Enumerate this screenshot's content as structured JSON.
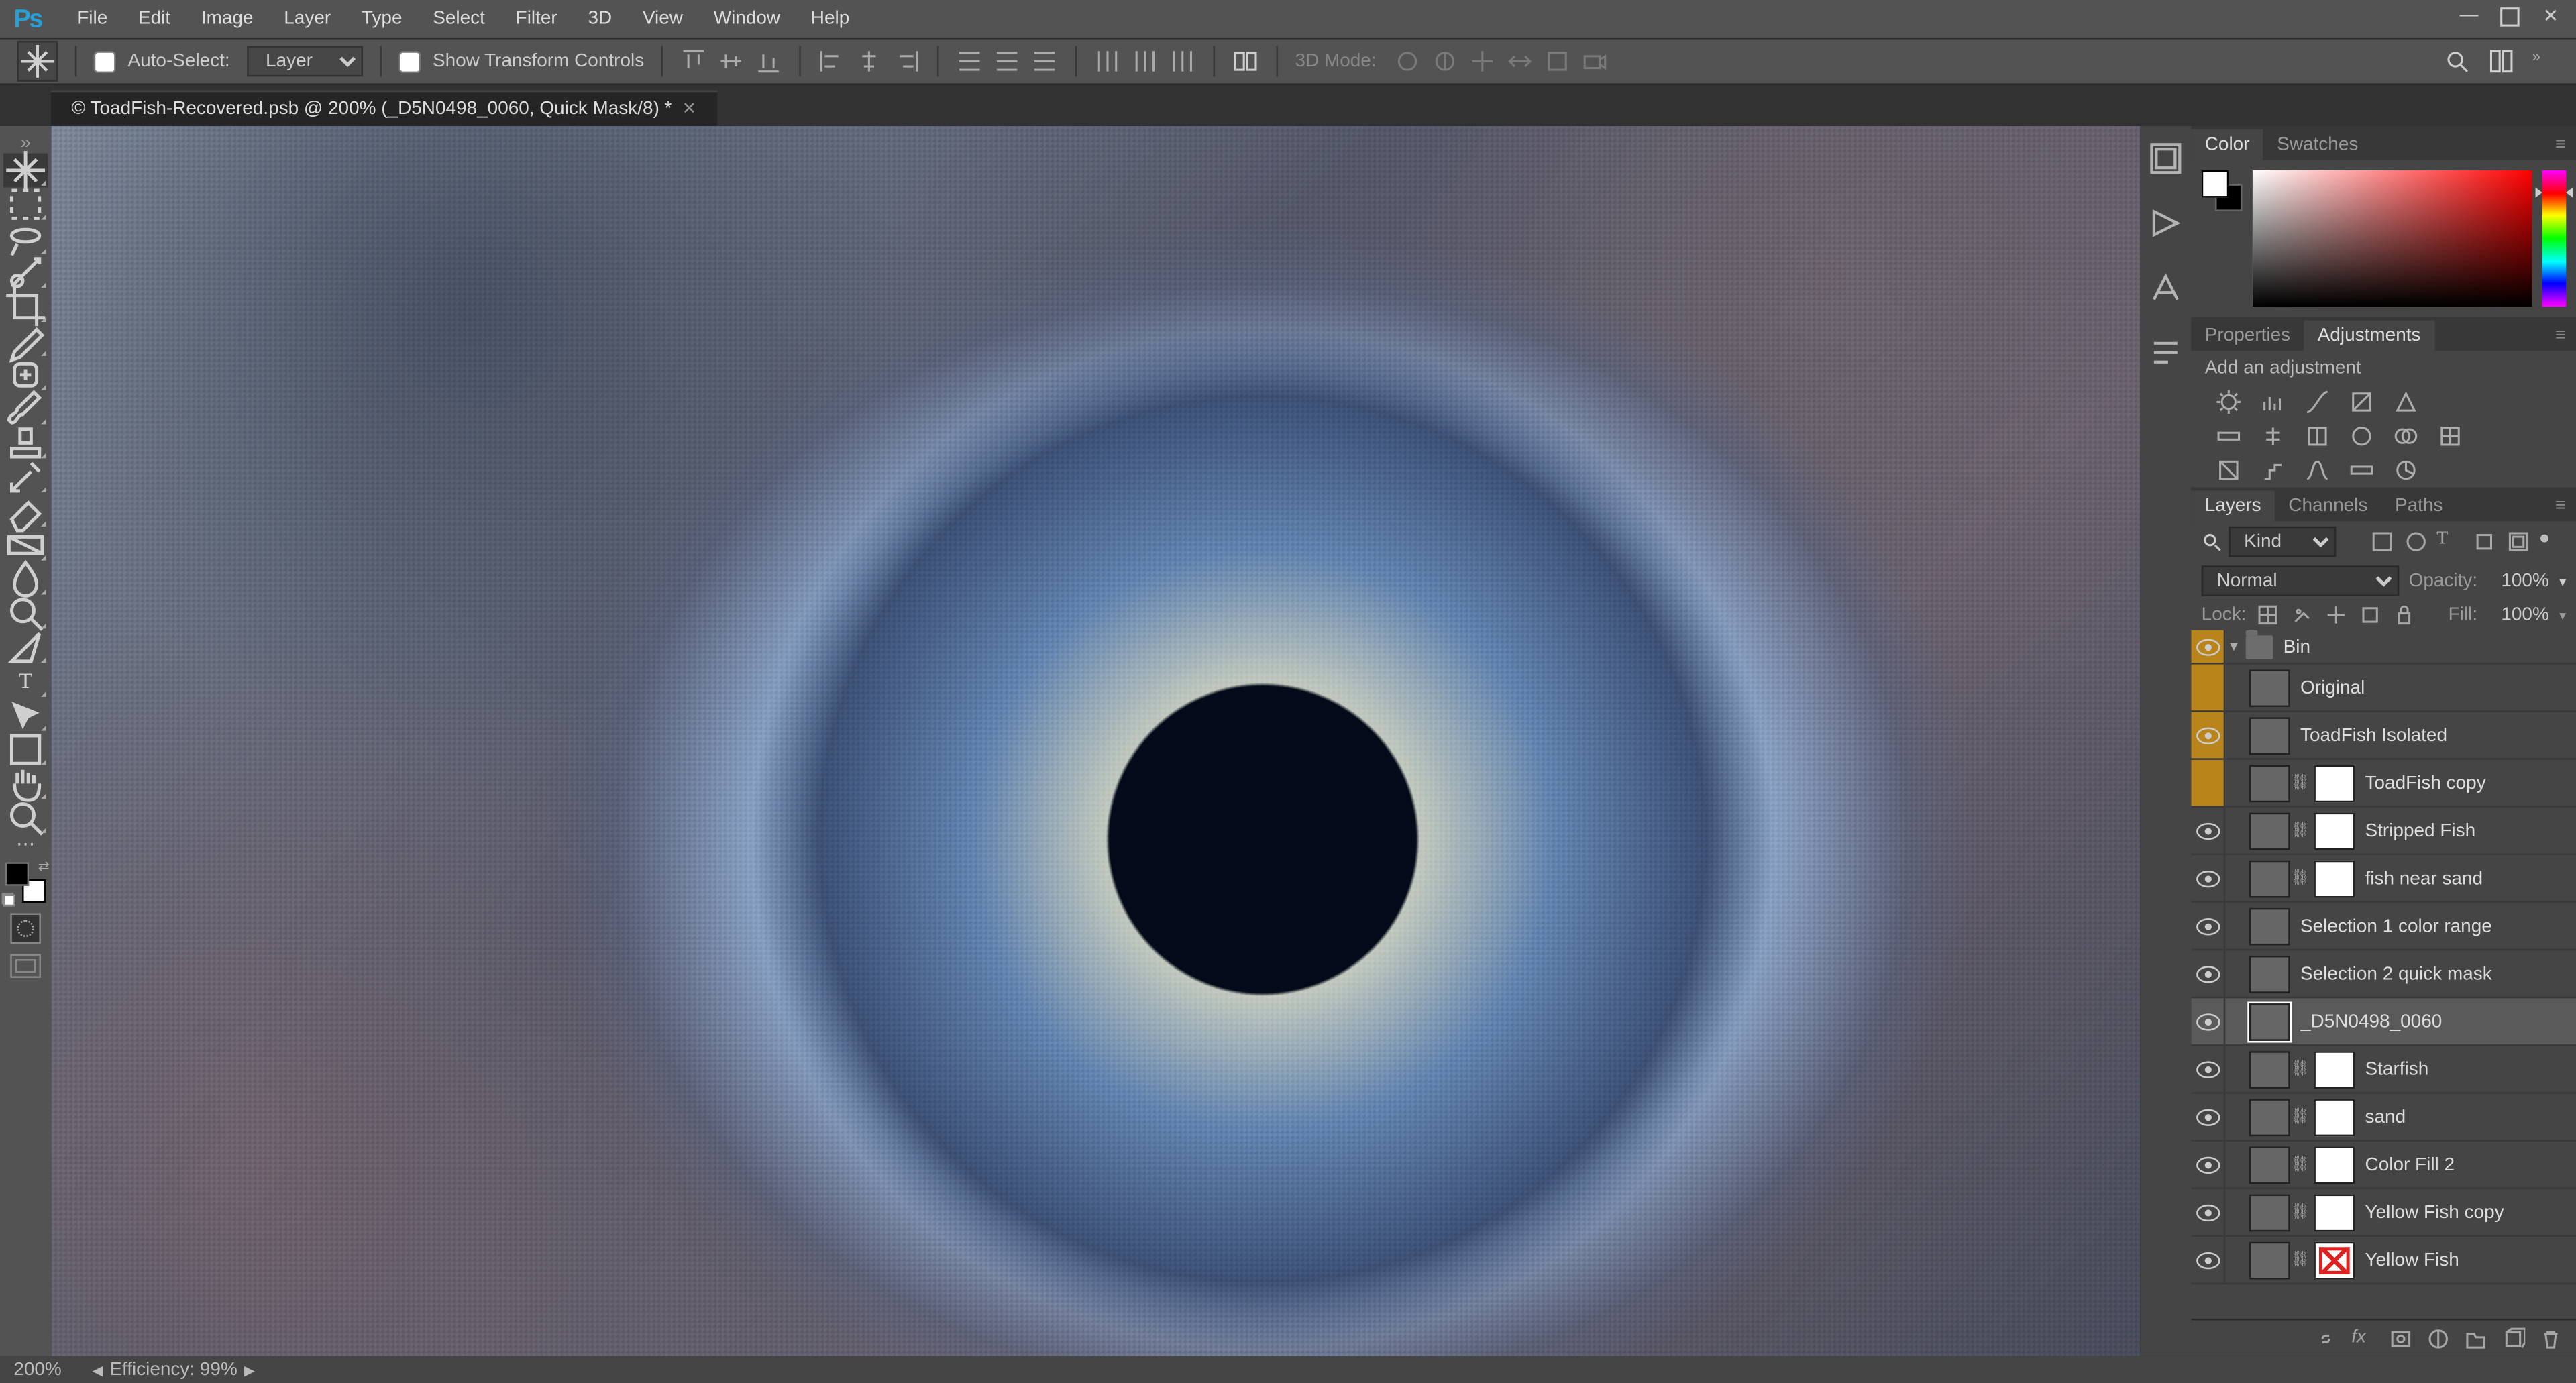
{
  "menu": {
    "items": [
      "File",
      "Edit",
      "Image",
      "Layer",
      "Type",
      "Select",
      "Filter",
      "3D",
      "View",
      "Window",
      "Help"
    ]
  },
  "options_bar": {
    "auto_select_label": "Auto-Select:",
    "auto_select_target": "Layer",
    "show_transform_label": "Show Transform Controls",
    "mode3d_label": "3D Mode:"
  },
  "document_tab": {
    "title": "© ToadFish-Recovered.psb @ 200% (_D5N0498_0060, Quick Mask/8) *"
  },
  "panels": {
    "color_tabs": [
      "Color",
      "Swatches"
    ],
    "props_tabs": [
      "Properties",
      "Adjustments"
    ],
    "props_header": "Add an adjustment",
    "layers_tabs": [
      "Layers",
      "Channels",
      "Paths"
    ]
  },
  "layers_panel": {
    "filter_kind": "Kind",
    "blend_mode": "Normal",
    "opacity_label": "Opacity:",
    "opacity_value": "100%",
    "fill_label": "Fill:",
    "fill_value": "100%",
    "lock_label": "Lock:",
    "group_name": "Bin",
    "layers": [
      {
        "name": "Original",
        "vis": "amber-off",
        "mask": false,
        "indent": 1
      },
      {
        "name": "ToadFish Isolated",
        "vis": "amber-on",
        "mask": false,
        "indent": 1
      },
      {
        "name": "ToadFish copy",
        "vis": "amber-off",
        "mask": true,
        "indent": 1
      },
      {
        "name": "Stripped Fish",
        "vis": "on",
        "mask": true,
        "indent": 1
      },
      {
        "name": "fish near sand",
        "vis": "on",
        "mask": true,
        "indent": 1
      },
      {
        "name": "Selection 1 color range",
        "vis": "on",
        "mask": false,
        "indent": 1
      },
      {
        "name": "Selection 2 quick mask",
        "vis": "on",
        "mask": false,
        "indent": 1
      },
      {
        "name": "_D5N0498_0060",
        "vis": "on",
        "mask": false,
        "indent": 1,
        "selected": true
      },
      {
        "name": "Starfish",
        "vis": "on",
        "mask": true,
        "indent": 1
      },
      {
        "name": "sand",
        "vis": "on",
        "mask": true,
        "indent": 1
      },
      {
        "name": "Color Fill 2",
        "vis": "on",
        "mask": true,
        "indent": 1
      },
      {
        "name": "Yellow Fish copy",
        "vis": "on",
        "mask": true,
        "indent": 1
      },
      {
        "name": "Yellow Fish",
        "vis": "on",
        "mask": true,
        "maskDisabled": true,
        "indent": 1
      }
    ]
  },
  "status": {
    "zoom": "200%",
    "efficiency": "Efficiency: 99%"
  }
}
